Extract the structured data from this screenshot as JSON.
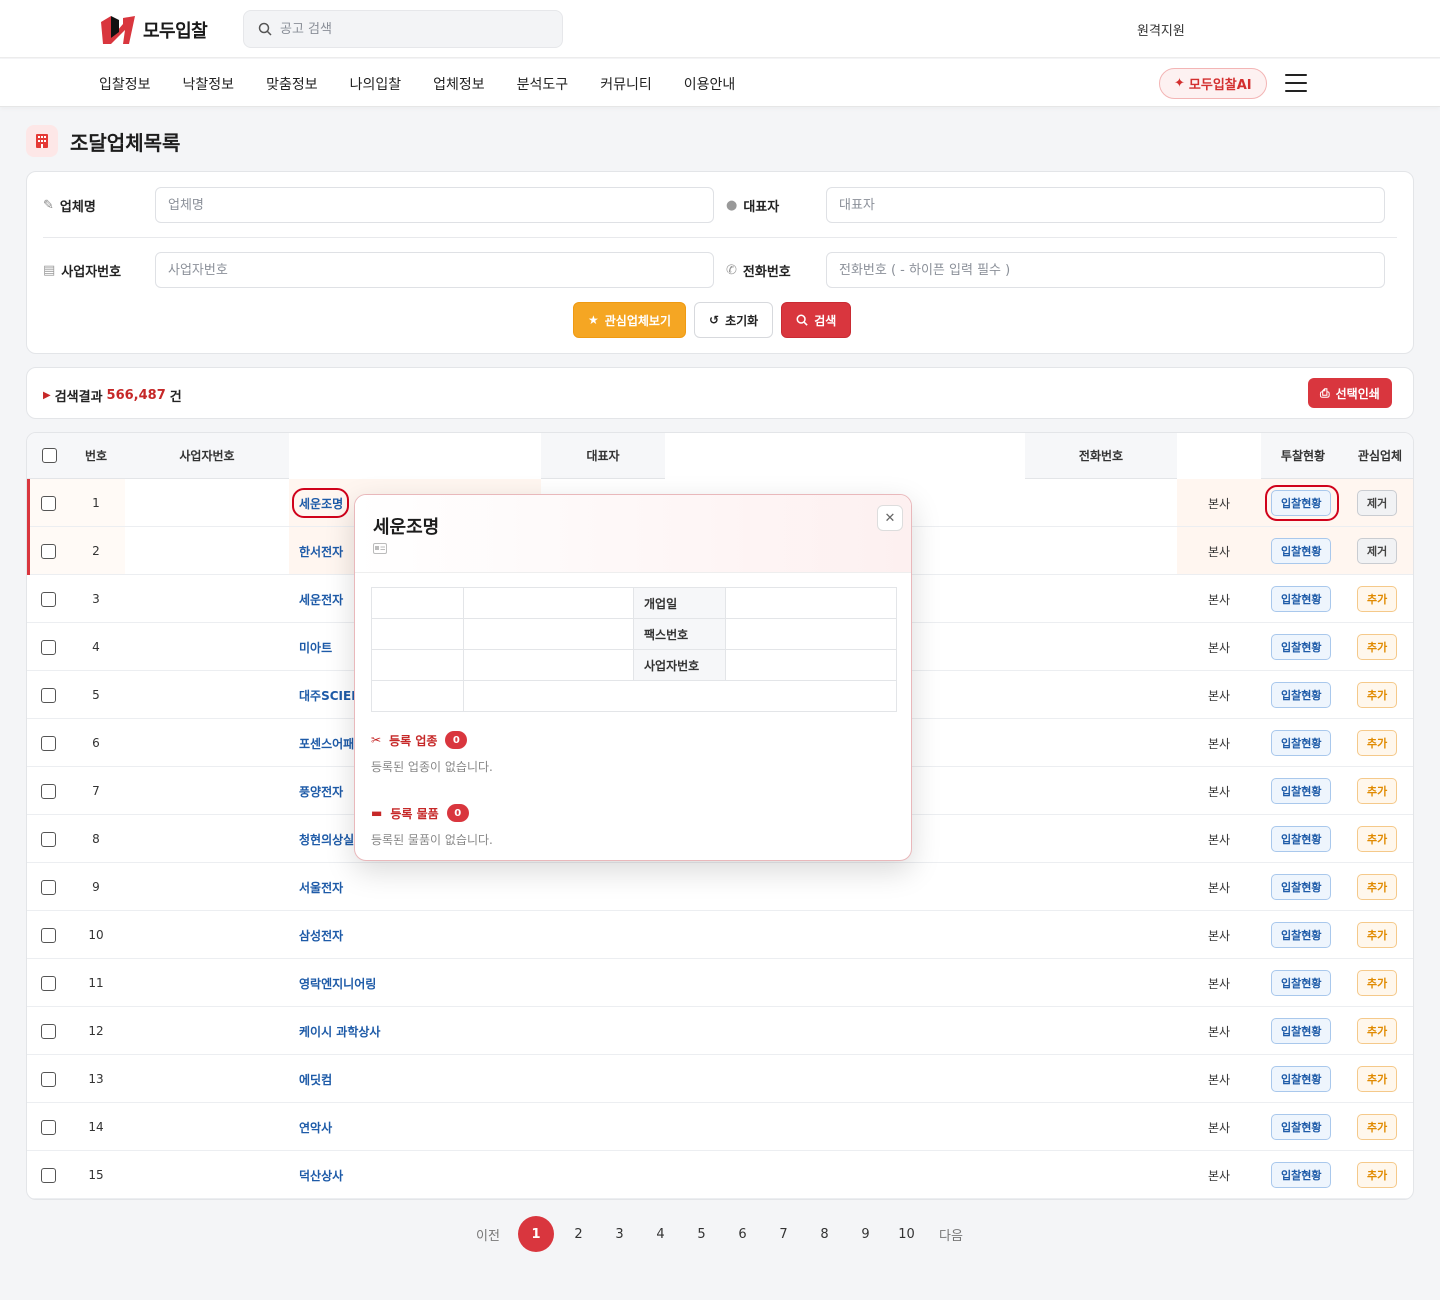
{
  "brand": {
    "name": "모두입찰",
    "accent": "#d9363e"
  },
  "search": {
    "placeholder": "공고 검색"
  },
  "header": {
    "remote_support": "원격지원"
  },
  "nav": {
    "items": [
      "입찰정보",
      "낙찰정보",
      "맞춤정보",
      "나의입찰",
      "업체정보",
      "분석도구",
      "커뮤니티",
      "이용안내"
    ],
    "ai_button": "모두입찰AI"
  },
  "page": {
    "title": "조달업체목록"
  },
  "filter": {
    "company_label": "업체명",
    "company_placeholder": "업체명",
    "ceo_label": "대표자",
    "ceo_placeholder": "대표자",
    "bizno_label": "사업자번호",
    "bizno_placeholder": "사업자번호",
    "phone_label": "전화번호",
    "phone_placeholder": "전화번호 ( - 하이픈 입력 필수 )",
    "fav_button": "관심업체보기",
    "reset_button": "초기화",
    "search_button": "검색"
  },
  "results": {
    "label": "검색결과",
    "count": "566,487",
    "unit": "건",
    "print_button": "선택인쇄"
  },
  "table": {
    "headers": {
      "no": "번호",
      "bizno": "사업자번호",
      "ceo": "대표자",
      "phone": "전화번호",
      "bid_status": "투찰현황",
      "favorite": "관심업체"
    },
    "bid_button": "입찰현황",
    "fav_add": "추가",
    "fav_remove": "제거",
    "rows": [
      {
        "no": "1",
        "name": "세운조명",
        "type": "본사",
        "fav": "제거"
      },
      {
        "no": "2",
        "name": "한서전자",
        "type": "본사",
        "fav": "제거"
      },
      {
        "no": "3",
        "name": "세운전자",
        "type": "본사",
        "fav": "추가"
      },
      {
        "no": "4",
        "name": "미아트",
        "type": "본사",
        "fav": "추가"
      },
      {
        "no": "5",
        "name": "대주SCIEN",
        "type": "본사",
        "fav": "추가"
      },
      {
        "no": "6",
        "name": "포센스어패",
        "type": "본사",
        "fav": "추가"
      },
      {
        "no": "7",
        "name": "풍양전자",
        "type": "본사",
        "fav": "추가"
      },
      {
        "no": "8",
        "name": "청현의상실",
        "type": "본사",
        "fav": "추가"
      },
      {
        "no": "9",
        "name": "서울전자",
        "type": "본사",
        "fav": "추가"
      },
      {
        "no": "10",
        "name": "삼성전자",
        "type": "본사",
        "fav": "추가"
      },
      {
        "no": "11",
        "name": "영락엔지니어링",
        "type": "본사",
        "fav": "추가"
      },
      {
        "no": "12",
        "name": "케이시 과학상사",
        "type": "본사",
        "fav": "추가"
      },
      {
        "no": "13",
        "name": "에딧컴",
        "type": "본사",
        "fav": "추가"
      },
      {
        "no": "14",
        "name": "연악사",
        "type": "본사",
        "fav": "추가"
      },
      {
        "no": "15",
        "name": "덕산상사",
        "type": "본사",
        "fav": "추가"
      }
    ]
  },
  "pagination": {
    "prev": "이전",
    "next": "다음",
    "current": "1",
    "pages": [
      "1",
      "2",
      "3",
      "4",
      "5",
      "6",
      "7",
      "8",
      "9",
      "10"
    ]
  },
  "popup": {
    "title": "세운조명",
    "info_labels": [
      "개업일",
      "팩스번호",
      "사업자번호"
    ],
    "industry_title": "등록 업종",
    "industry_count": "0",
    "industry_empty": "등록된 업종이 없습니다.",
    "product_title": "등록 물품",
    "product_count": "0",
    "product_empty": "등록된 물품이 없습니다."
  }
}
